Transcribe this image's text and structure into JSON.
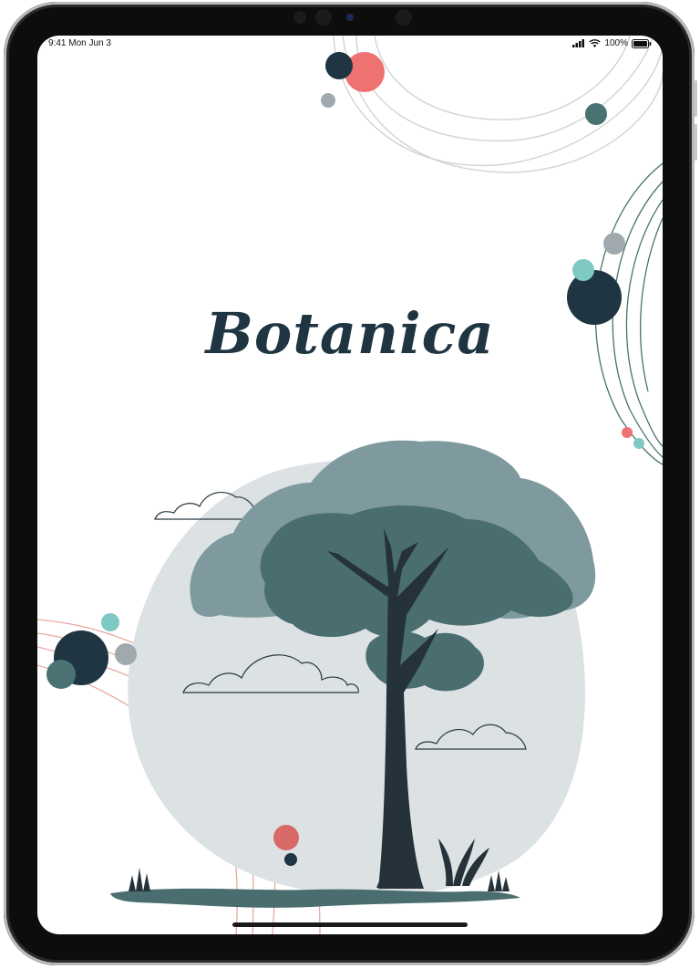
{
  "status_bar": {
    "time": "9:41",
    "date": "Mon Jun 3",
    "battery": "100%"
  },
  "app": {
    "title": "Botanica"
  },
  "colors": {
    "navy": "#1f3541",
    "coral": "#ef7272",
    "teal": "#4a7273",
    "mint": "#7fc9c3",
    "gray": "#a0a9ae",
    "blob": "#dce1e3",
    "canopy_light": "#7e9a9e",
    "canopy_dark": "#4a6e70",
    "trunk": "#263239"
  },
  "icons": [
    "signal-icon",
    "wifi-icon",
    "battery-icon"
  ],
  "illustration": {
    "subject": "tree-illustration"
  }
}
